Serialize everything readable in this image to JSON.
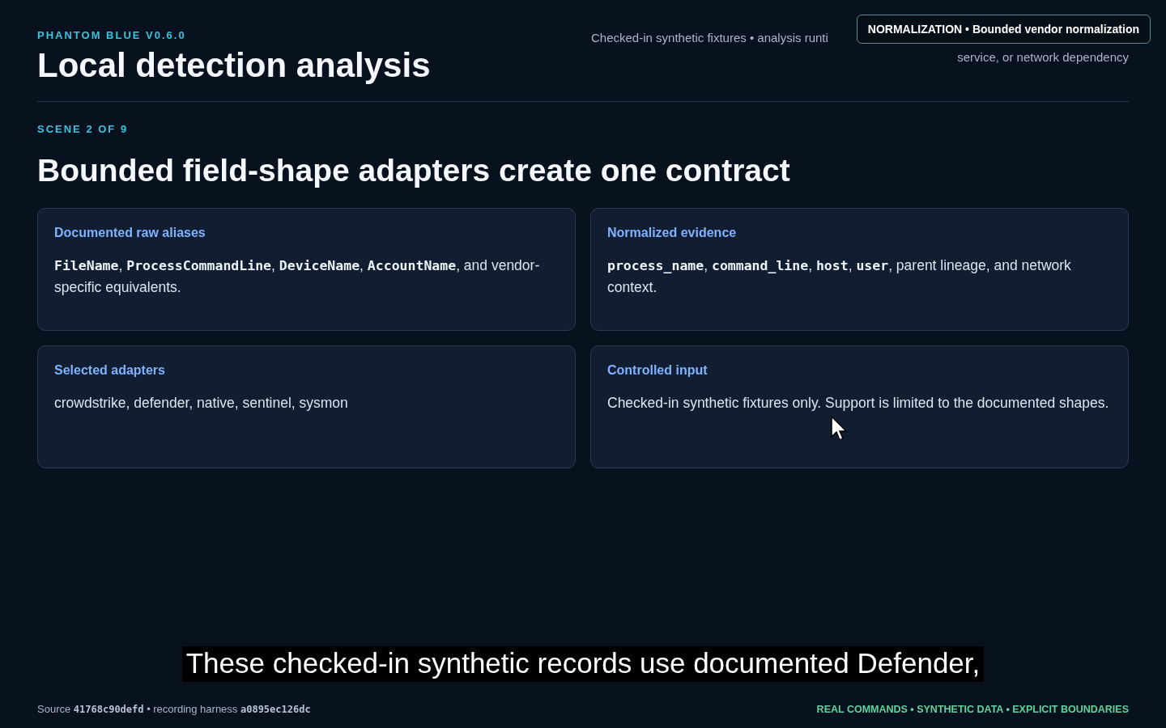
{
  "header": {
    "eyebrow": "PHANTOM BLUE V0.6.0",
    "title": "Local detection analysis",
    "note_lines": [
      "Checked-in synthetic fixtures • analysis runti",
      "service, or network dependency"
    ]
  },
  "tooltip": {
    "text": "NORMALIZATION • Bounded vendor normalization"
  },
  "scene": {
    "label": "SCENE 2 OF 9",
    "heading": "Bounded field-shape adapters create one contract"
  },
  "cards": [
    {
      "title": "Documented raw aliases",
      "body": [
        {
          "kind": "code",
          "text": "FileName"
        },
        {
          "kind": "text",
          "text": ", "
        },
        {
          "kind": "code",
          "text": "ProcessCommandLine"
        },
        {
          "kind": "text",
          "text": ", "
        },
        {
          "kind": "code",
          "text": "DeviceName"
        },
        {
          "kind": "text",
          "text": ", "
        },
        {
          "kind": "code",
          "text": "AccountName"
        },
        {
          "kind": "text",
          "text": ", and vendor-specific equivalents."
        }
      ]
    },
    {
      "title": "Normalized evidence",
      "body": [
        {
          "kind": "code",
          "text": "process_name"
        },
        {
          "kind": "text",
          "text": ", "
        },
        {
          "kind": "code",
          "text": "command_line"
        },
        {
          "kind": "text",
          "text": ", "
        },
        {
          "kind": "code",
          "text": "host"
        },
        {
          "kind": "text",
          "text": ", "
        },
        {
          "kind": "code",
          "text": "user"
        },
        {
          "kind": "text",
          "text": ", parent lineage, and network context."
        }
      ]
    },
    {
      "title": "Selected adapters",
      "body": [
        {
          "kind": "text",
          "text": "crowdstrike, defender, native, sentinel, sysmon"
        }
      ]
    },
    {
      "title": "Controlled input",
      "body": [
        {
          "kind": "text",
          "text": "Checked-in synthetic fixtures only. Support is limited to the documented shapes."
        }
      ]
    }
  ],
  "caption": "These checked-in synthetic records use documented Defender,",
  "footer": {
    "source": [
      {
        "kind": "text",
        "text": "Source "
      },
      {
        "kind": "code",
        "text": "41768c90defd"
      },
      {
        "kind": "text",
        "text": " • recording harness "
      },
      {
        "kind": "code",
        "text": "a0895ec126dc"
      }
    ],
    "tagline": "REAL COMMANDS • SYNTHETIC DATA • EXPLICIT BOUNDARIES"
  }
}
